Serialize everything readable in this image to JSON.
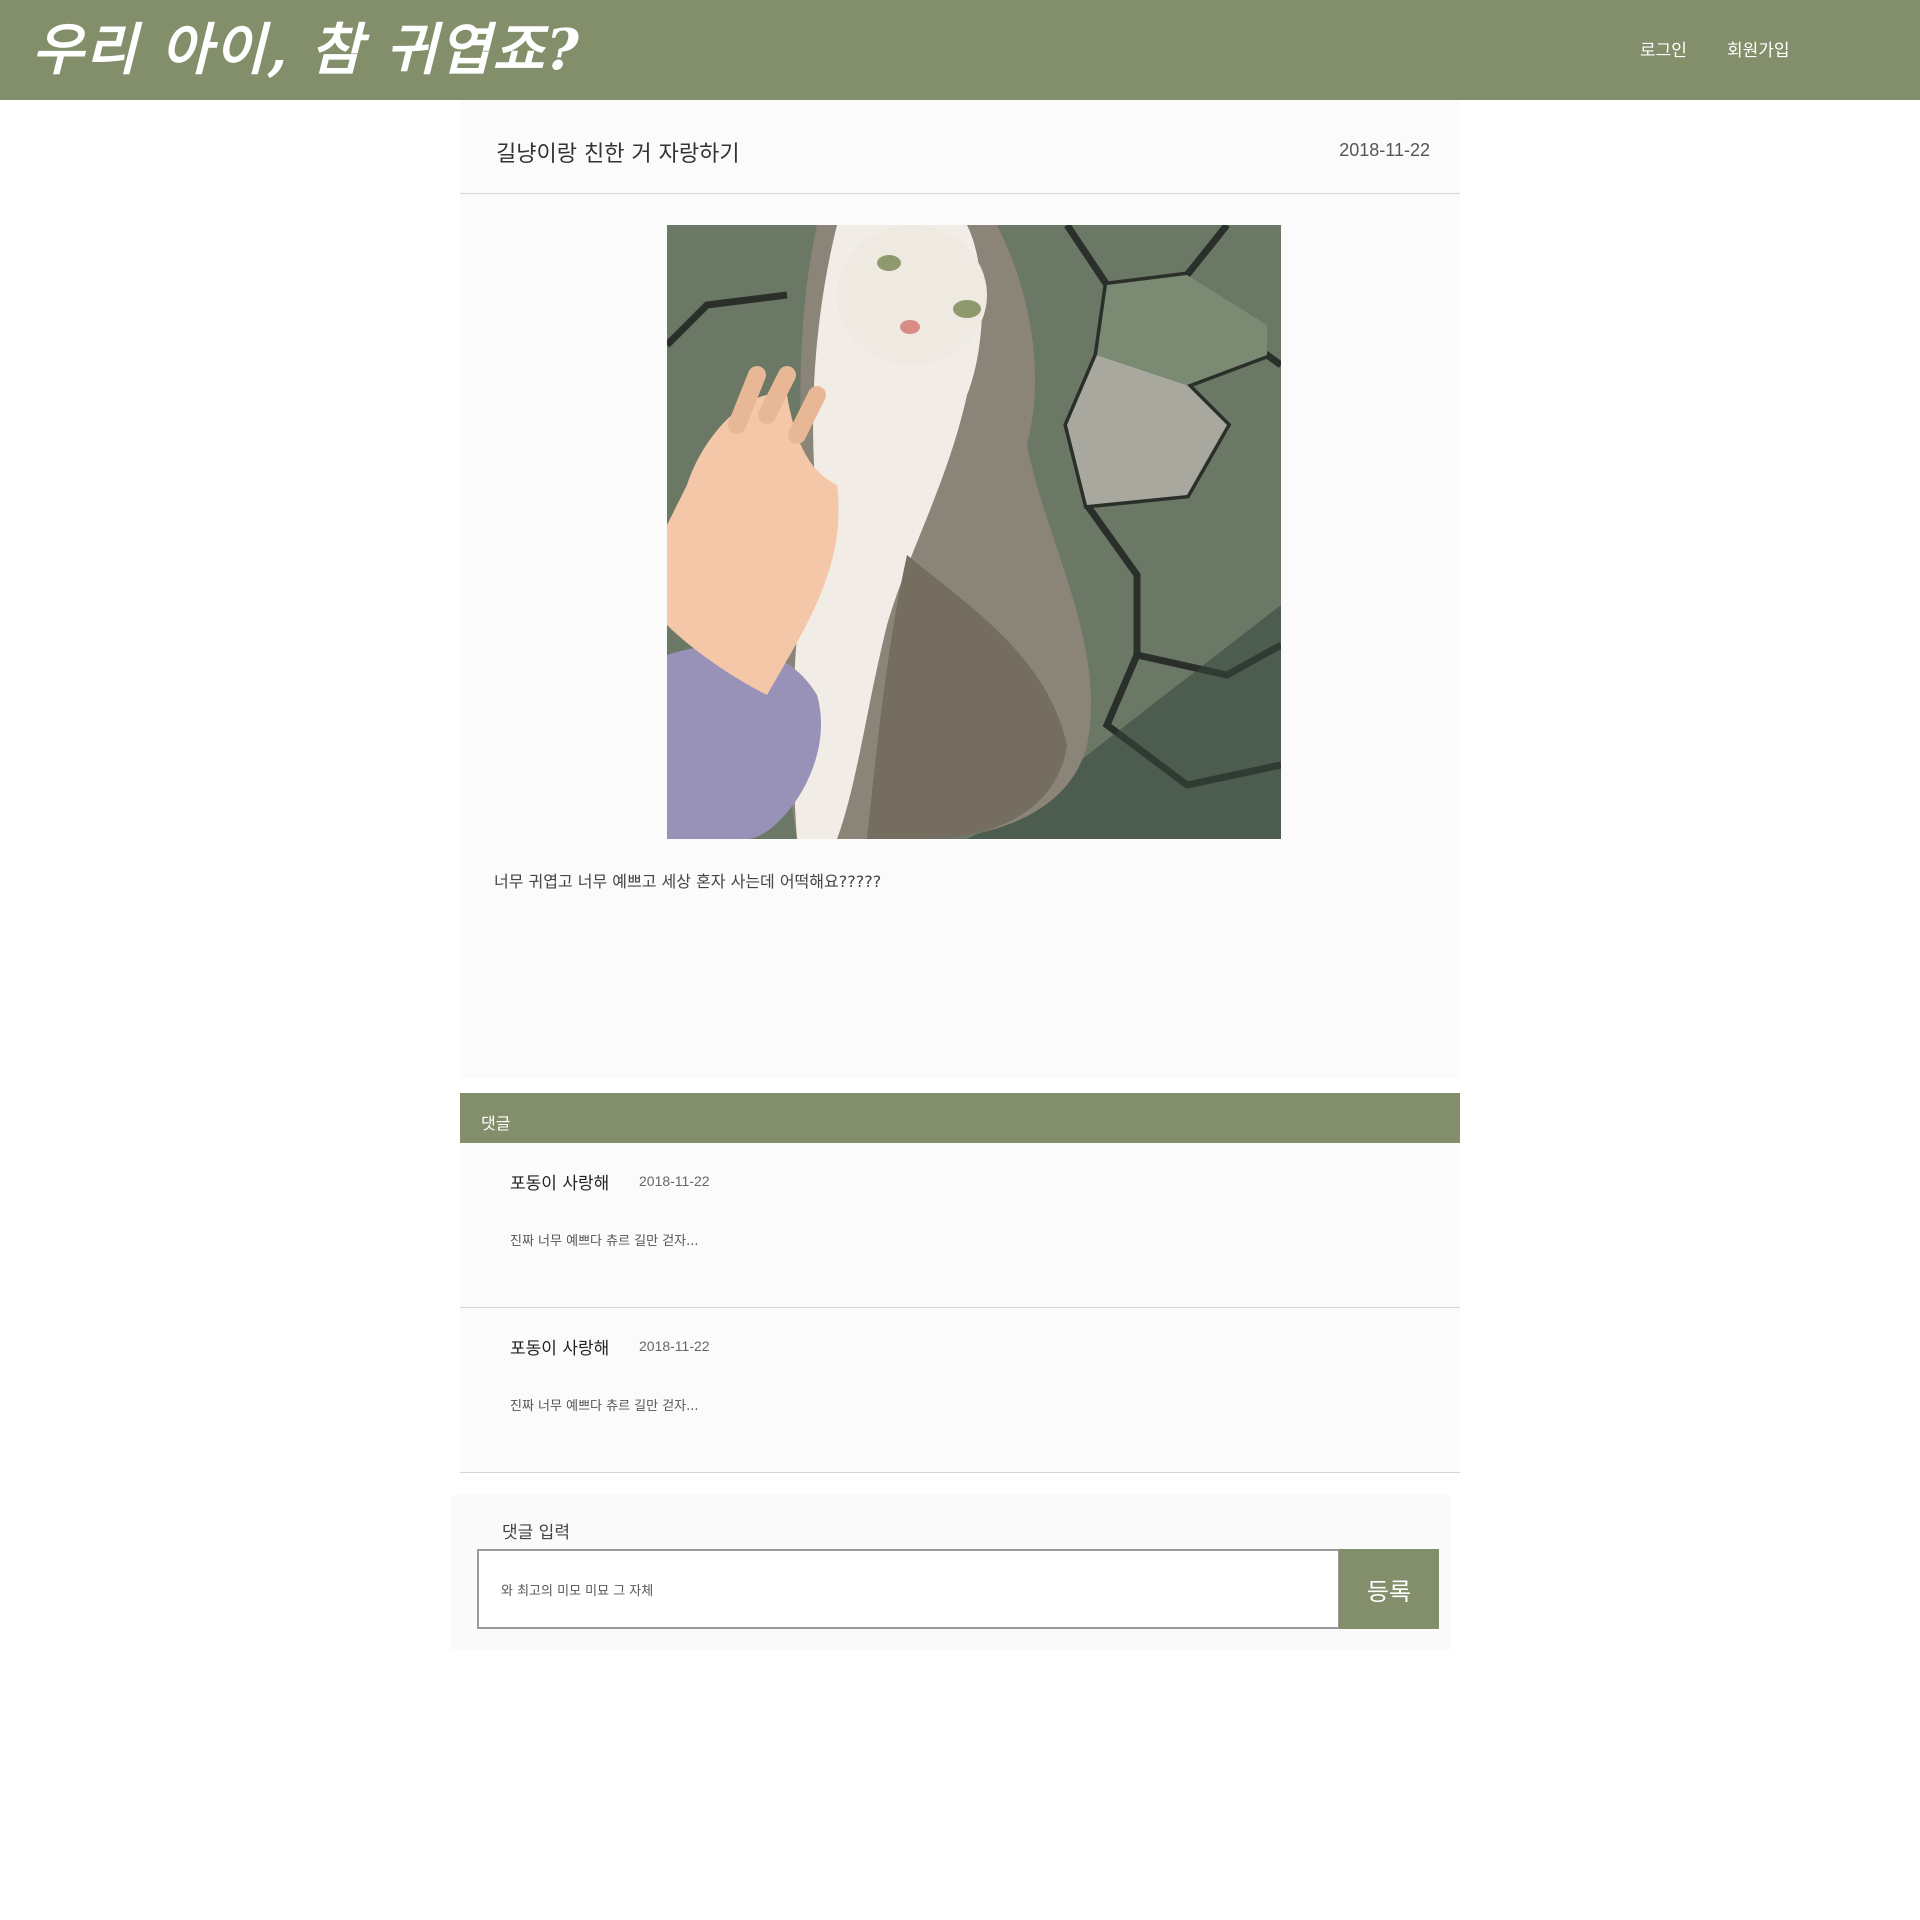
{
  "header": {
    "logo_text": "우리 아이, 참 귀엽죠?",
    "nav": {
      "login": "로그인",
      "signup": "회원가입"
    },
    "bg_color": "#838f6a"
  },
  "post": {
    "title": "길냥이랑 친한 거 자랑하기",
    "date": "2018-11-22",
    "body": "너무 귀엽고 너무 예쁘고 세상 혼자 사는데 어떡해요?????"
  },
  "comments": {
    "header": "댓글",
    "items": [
      {
        "author": "포동이 사랑해",
        "date": "2018-11-22",
        "text": "진짜 너무 예쁘다 츄르 길만 걷자..."
      },
      {
        "author": "포동이 사랑해",
        "date": "2018-11-22",
        "text": "진짜 너무 예쁘다 츄르 길만 걷자..."
      }
    ]
  },
  "comment_form": {
    "label": "댓글 입력",
    "value": "와 최고의 미모 미묘 그 자체",
    "submit_label": "등록"
  }
}
